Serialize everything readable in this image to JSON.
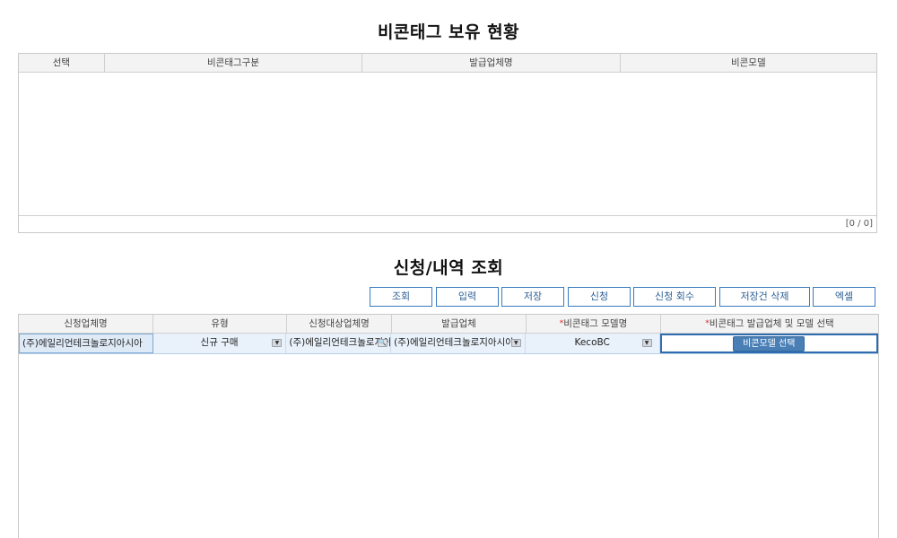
{
  "section1": {
    "title": "비콘태그 보유 현황",
    "columns": [
      "선택",
      "비콘태그구분",
      "발급업체명",
      "비콘모델"
    ],
    "pager": "[0 / 0]"
  },
  "section2": {
    "title": "신청/내역 조회",
    "buttons": [
      "조회",
      "입력",
      "저장",
      "신청",
      "신청 회수",
      "저장건 삭제",
      "엑셀"
    ],
    "columns": [
      "신청업체명",
      "유형",
      "신청대상업체명",
      "발급업체",
      "비콘태그 모델명",
      "비콘태그 발급업체 및 모델 선택"
    ],
    "required_mark": "*",
    "row": {
      "company": "(주)에일리언테크놀로지아시아",
      "type": "신규 구매",
      "target_company": "(주)에일리언테크놀로지아시아",
      "issuer": "(주)에일리언테크놀로지아시아",
      "model": "KecoBC",
      "select_button": "비콘모델 선택"
    }
  },
  "icons": {
    "dropdown": "chevron-down-icon",
    "search": "magnifier-icon"
  },
  "colors": {
    "button_border": "#3a7bbf",
    "selected_row": "#e9f1fa",
    "required": "#e02020",
    "model_button": "#4a7fb6"
  }
}
